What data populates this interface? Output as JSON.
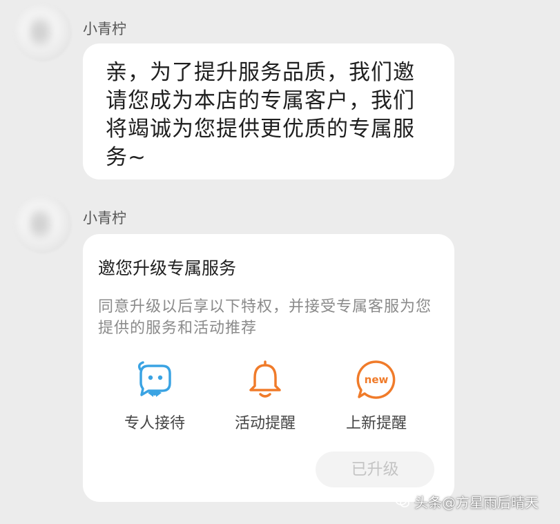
{
  "message1": {
    "sender": "小青柠",
    "text": "亲，为了提升服务品质，我们邀请您成为本店的专属客户，我们将竭诚为您提供更优质的专属服务~"
  },
  "message2": {
    "sender": "小青柠",
    "card": {
      "title": "邀您升级专属服务",
      "description": "同意升级以后享以下特权，并接受专属客服为您提供的服务和活动推荐",
      "perks": [
        {
          "label": "专人接待",
          "icon": "customer-service-icon"
        },
        {
          "label": "活动提醒",
          "icon": "bell-icon"
        },
        {
          "label": "上新提醒",
          "icon": "new-badge-icon",
          "badge_text": "new"
        }
      ],
      "button_label": "已升级"
    }
  },
  "watermark": {
    "text": "头条@方星雨后晴天"
  },
  "colors": {
    "background": "#ececec",
    "bubble": "#ffffff",
    "accent_blue": "#3aa3e3",
    "accent_orange": "#f07b2a",
    "button_bg": "#f3f3f3",
    "button_text": "#c4c4c4"
  }
}
